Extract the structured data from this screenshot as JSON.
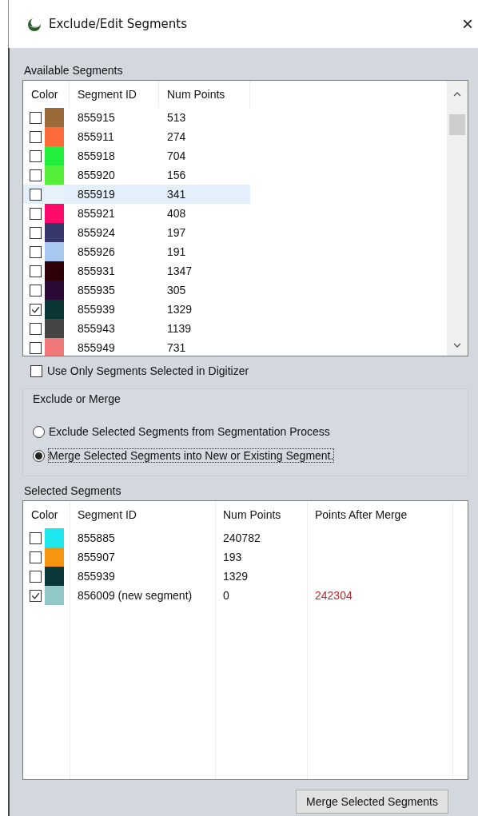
{
  "window": {
    "title": "Exclude/Edit Segments",
    "close": "×"
  },
  "available_segments": {
    "label": "Available Segments",
    "columns": [
      "Color",
      "Segment ID",
      "Num Points"
    ],
    "rows": [
      {
        "checked": false,
        "color": "#9b6a3a",
        "segment_id": "855915",
        "num_points": "513",
        "selected": false
      },
      {
        "checked": false,
        "color": "#ff6a3a",
        "segment_id": "855911",
        "num_points": "274",
        "selected": false
      },
      {
        "checked": false,
        "color": "#22ee3c",
        "segment_id": "855918",
        "num_points": "704",
        "selected": false
      },
      {
        "checked": false,
        "color": "#55ee38",
        "segment_id": "855920",
        "num_points": "156",
        "selected": false
      },
      {
        "checked": false,
        "color": "#e8f2fb",
        "segment_id": "855919",
        "num_points": "341",
        "selected": true
      },
      {
        "checked": false,
        "color": "#ff0a6a",
        "segment_id": "855921",
        "num_points": "408",
        "selected": false
      },
      {
        "checked": false,
        "color": "#35376a",
        "segment_id": "855924",
        "num_points": "197",
        "selected": false
      },
      {
        "checked": false,
        "color": "#a9c8ef",
        "segment_id": "855926",
        "num_points": "191",
        "selected": false
      },
      {
        "checked": false,
        "color": "#300008",
        "segment_id": "855931",
        "num_points": "1347",
        "selected": false
      },
      {
        "checked": false,
        "color": "#2a0a35",
        "segment_id": "855935",
        "num_points": "305",
        "selected": false
      },
      {
        "checked": true,
        "color": "#0a3535",
        "segment_id": "855939",
        "num_points": "1329",
        "selected": false
      },
      {
        "checked": false,
        "color": "#444444",
        "segment_id": "855943",
        "num_points": "1139",
        "selected": false
      },
      {
        "checked": false,
        "color": "#f07878",
        "segment_id": "855949",
        "num_points": "731",
        "selected": false
      }
    ]
  },
  "use_only_digitizer": {
    "label": "Use Only Segments Selected in Digitizer",
    "checked": false
  },
  "exclude_or_merge": {
    "label": "Exclude or Merge",
    "options": [
      {
        "label": "Exclude Selected Segments from Segmentation Process",
        "selected": false
      },
      {
        "label": "Merge Selected Segments into New or Existing Segment.",
        "selected": true
      }
    ]
  },
  "selected_segments": {
    "label": "Selected Segments",
    "columns": [
      "Color",
      "Segment ID",
      "Num Points",
      "Points After Merge"
    ],
    "rows": [
      {
        "checked": false,
        "color": "#1ee8ee",
        "segment_id": "855885",
        "num_points": "240782"
      },
      {
        "checked": false,
        "color": "#f79410",
        "segment_id": "855907",
        "num_points": "193"
      },
      {
        "checked": false,
        "color": "#0a3838",
        "segment_id": "855939",
        "num_points": "1329"
      },
      {
        "checked": true,
        "color": "#92c8c8",
        "segment_id": "856009 (new segment)",
        "num_points": "0",
        "points_after_merge": "242304"
      }
    ]
  },
  "merge_button": "Merge Selected Segments"
}
